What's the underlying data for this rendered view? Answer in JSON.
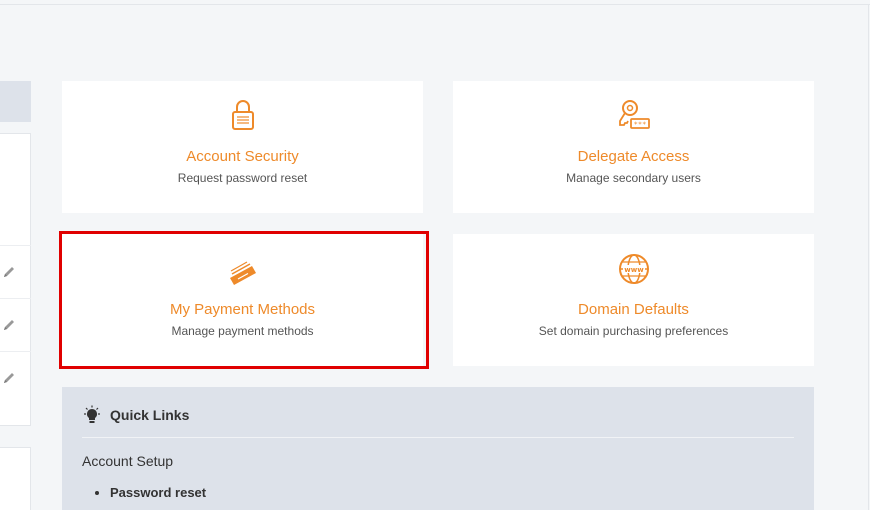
{
  "cards": [
    {
      "title": "Account Security",
      "subtitle": "Request password reset",
      "icon": "padlock-icon"
    },
    {
      "title": "Delegate Access",
      "subtitle": "Manage secondary users",
      "icon": "key-icon"
    },
    {
      "title": "My Payment Methods",
      "subtitle": "Manage payment methods",
      "icon": "credit-card-icon"
    },
    {
      "title": "Domain Defaults",
      "subtitle": "Set domain purchasing preferences",
      "icon": "globe-www-icon"
    }
  ],
  "quick_links": {
    "title": "Quick Links",
    "section": "Account Setup",
    "items": [
      "Password reset"
    ]
  },
  "colors": {
    "accent": "#ee8a2a",
    "highlight": "#e00000",
    "panel": "#dde2ea"
  }
}
